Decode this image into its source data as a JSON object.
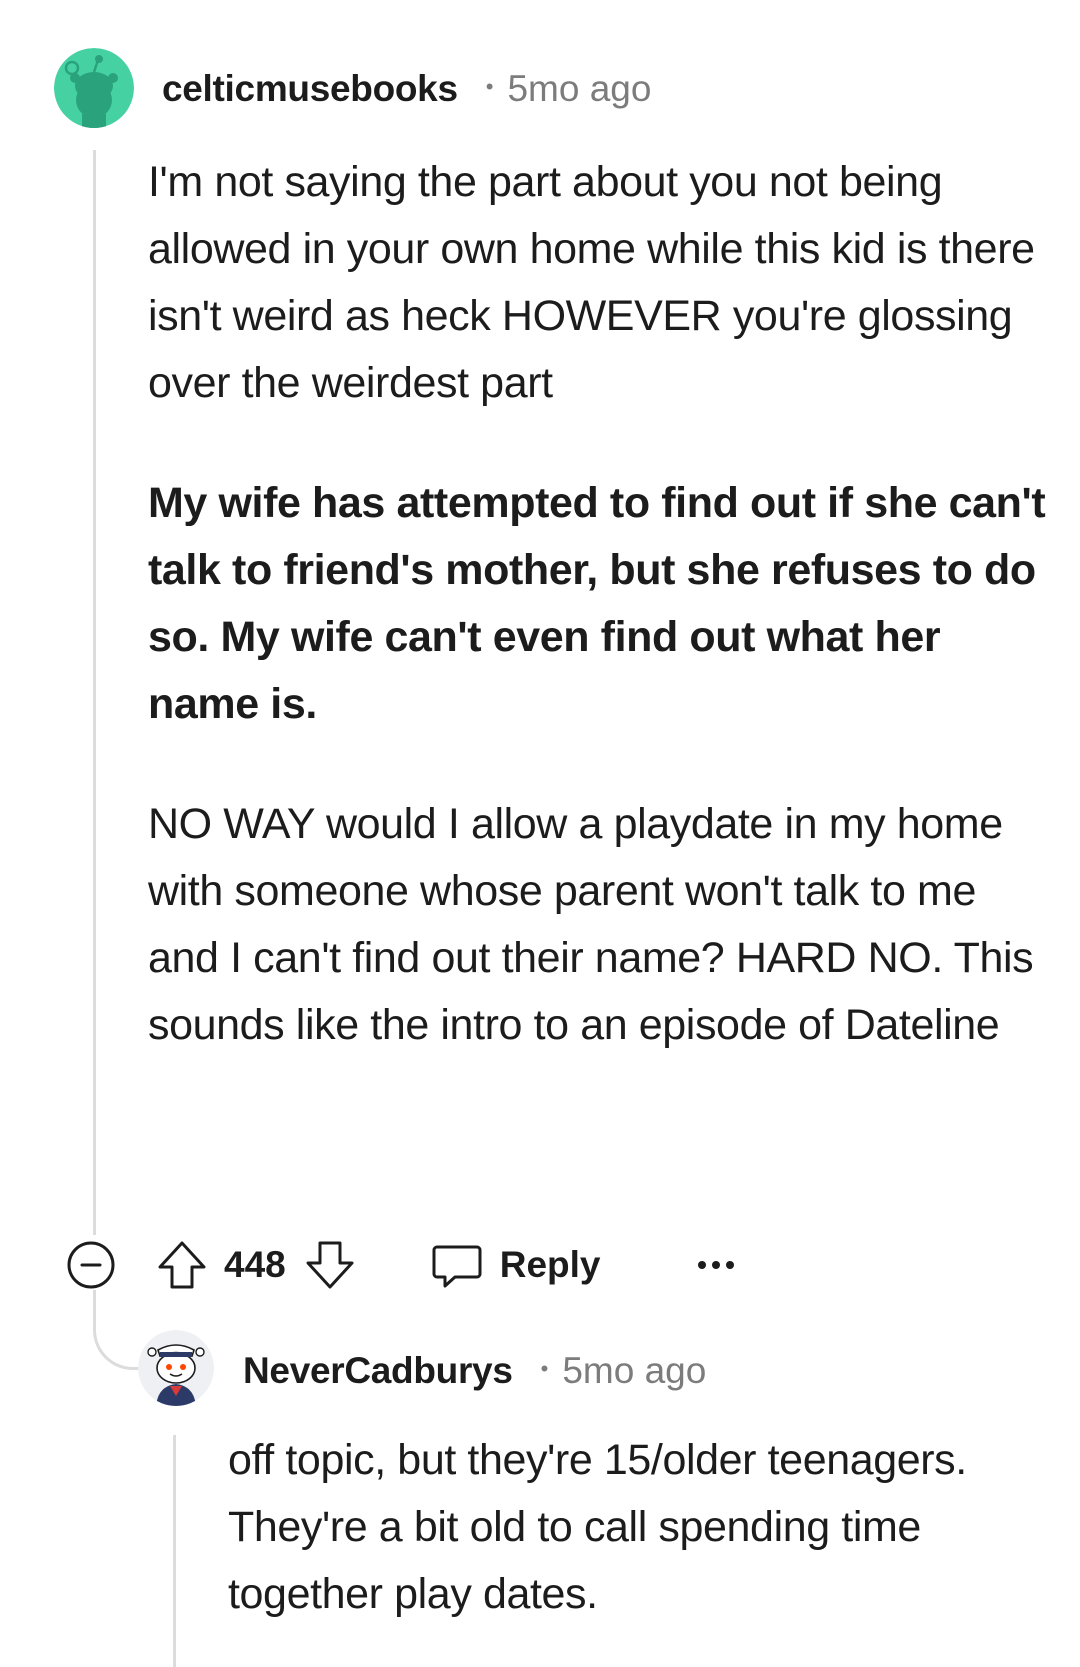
{
  "comments": [
    {
      "username": "celticmusebooks",
      "separator": "•",
      "timestamp": "5mo ago",
      "avatar_icon": "snoo-avatar-teal-icon",
      "paragraphs": [
        "I'm not saying the part about you not being allowed in your own home while this kid is there isn't weird as heck HOWEVER you're glossing over the weirdest part",
        "My wife has attempted to find out if she can't talk to friend's mother, but she refuses to do so. My wife can't even find out what her name is.",
        "NO WAY would I allow a playdate in my home with someone whose parent won't talk to me and I can't find out their name? HARD NO. This sounds like the intro to an episode of Dateline"
      ],
      "actions": {
        "collapse_icon": "collapse-minus-icon",
        "upvote_icon": "upvote-arrow-icon",
        "score": "448",
        "downvote_icon": "downvote-arrow-icon",
        "reply_icon": "speech-bubble-icon",
        "reply_label": "Reply",
        "more_icon": "more-dots-icon"
      }
    },
    {
      "username": "NeverCadburys",
      "separator": "•",
      "timestamp": "5mo ago",
      "avatar_icon": "snoo-sailor-avatar-icon",
      "paragraphs": [
        "off topic, but they're 15/older teenagers. They're a bit old to call spending time together play dates."
      ]
    }
  ],
  "colors": {
    "text": "#1c1c1c",
    "meta": "#7c7c7c",
    "thread_line": "#dcdcdc",
    "avatar_teal": "#46d1a3"
  }
}
